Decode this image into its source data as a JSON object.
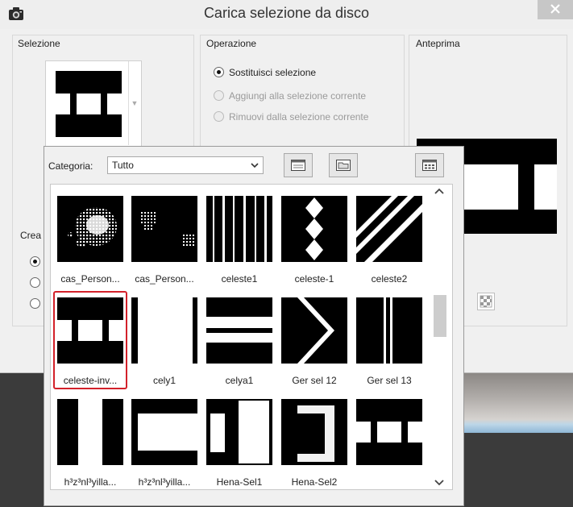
{
  "window": {
    "title": "Carica selezione da disco"
  },
  "groups": {
    "selection": "Selezione",
    "operation": "Operazione",
    "preview": "Anteprima",
    "create": "Crea"
  },
  "operation_options": [
    {
      "label": "Sostituisci selezione",
      "checked": true,
      "enabled": true
    },
    {
      "label": "Aggiungi alla selezione corrente",
      "checked": false,
      "enabled": false
    },
    {
      "label": "Rimuovi dalla selezione corrente",
      "checked": false,
      "enabled": false
    }
  ],
  "popup": {
    "category_label": "Categoria:",
    "category_value": "Tutto"
  },
  "thumbnails": [
    {
      "label": "cas_Person...",
      "selected": false
    },
    {
      "label": "cas_Person...",
      "selected": false
    },
    {
      "label": "celeste1",
      "selected": false
    },
    {
      "label": "celeste-1",
      "selected": false
    },
    {
      "label": "celeste2",
      "selected": false
    },
    {
      "label": "celeste-inv...",
      "selected": true
    },
    {
      "label": "cely1",
      "selected": false
    },
    {
      "label": "celya1",
      "selected": false
    },
    {
      "label": "Ger sel  12",
      "selected": false
    },
    {
      "label": "Ger sel  13",
      "selected": false
    },
    {
      "label": "h³z³nl³yilla...",
      "selected": false
    },
    {
      "label": "h³z³nl³yilla...",
      "selected": false
    },
    {
      "label": "Hena-Sel1",
      "selected": false
    },
    {
      "label": "Hena-Sel2",
      "selected": false
    },
    {
      "label": "",
      "selected": false
    }
  ],
  "colors": {
    "highlight": "#d3212a",
    "close_bg": "#c7c7c7"
  }
}
